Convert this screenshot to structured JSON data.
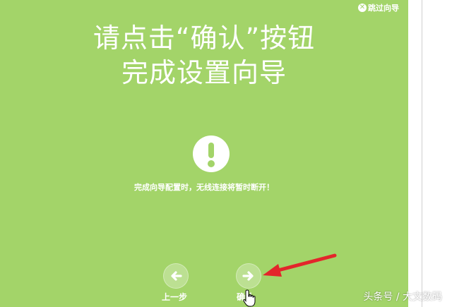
{
  "wizard": {
    "skip_label": "跳过向导",
    "title_line1": "请点击“确认”按钮",
    "title_line2": "完成设置向导",
    "message": "完成向导配置时，无线连接将暂时断开！",
    "prev_label": "上一步",
    "next_label": "确认"
  },
  "watermark": {
    "text": "头条号 / 大文数码"
  },
  "colors": {
    "panel_bg": "#a3d469",
    "annotation_arrow": "#e3262b"
  },
  "icons": [
    "close-circle-icon",
    "exclamation-icon",
    "arrow-left-icon",
    "arrow-right-icon",
    "pointer-hand-icon"
  ]
}
